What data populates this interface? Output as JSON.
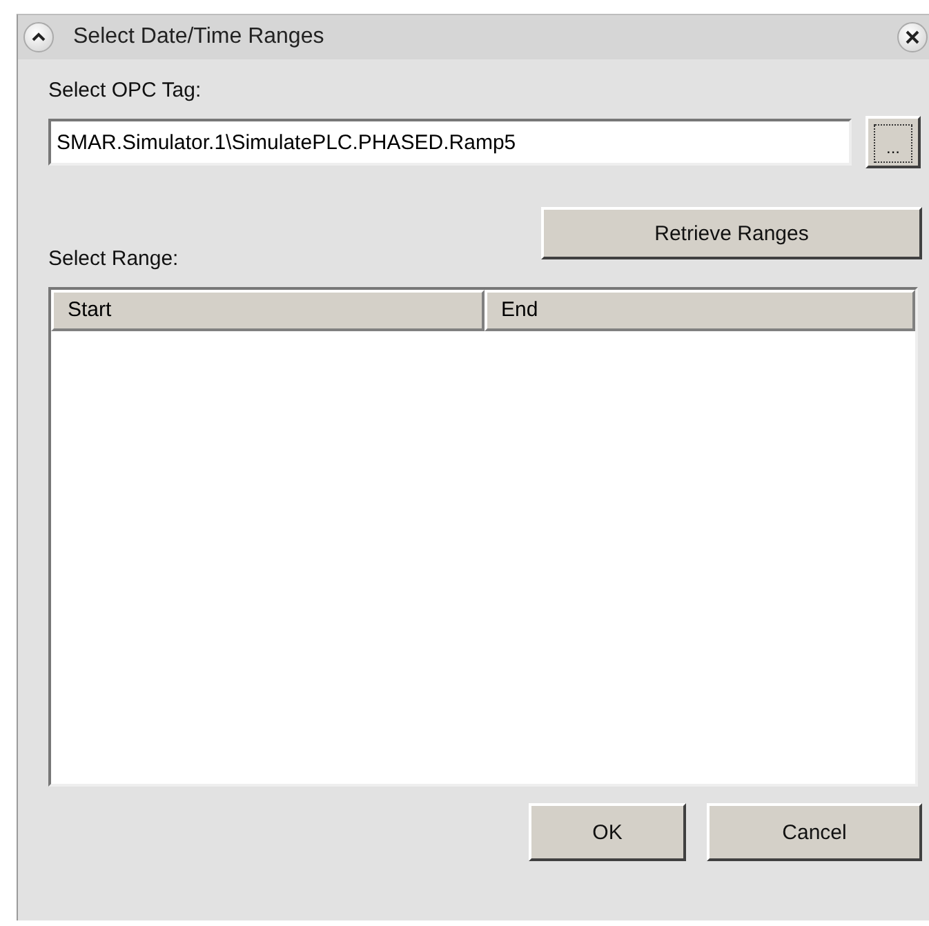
{
  "window": {
    "title": "Select Date/Time Ranges",
    "collapsed": false
  },
  "tag": {
    "label": "Select OPC Tag:",
    "value": "SMAR.Simulator.1\\SimulatePLC.PHASED.Ramp5",
    "browse_button": "..."
  },
  "retrieve_button": "Retrieve Ranges",
  "range": {
    "label": "Select Range:",
    "columns": [
      "Start",
      "End"
    ]
  },
  "buttons": [
    "OK",
    "Cancel"
  ]
}
